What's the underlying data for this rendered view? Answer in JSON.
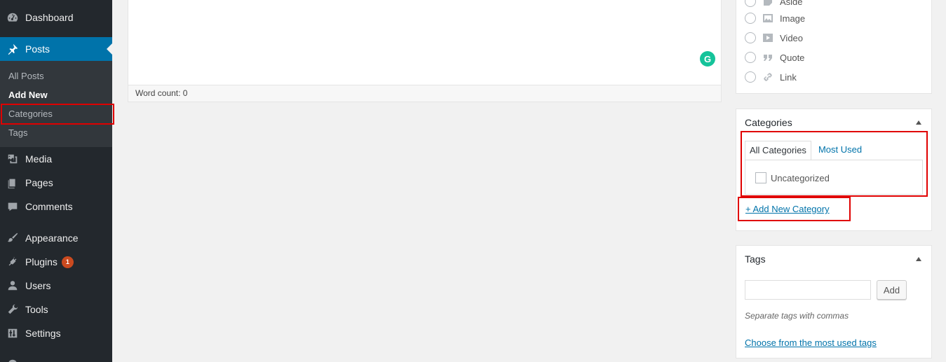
{
  "sidebar": {
    "dashboard": "Dashboard",
    "posts": "Posts",
    "posts_sub": [
      "All Posts",
      "Add New",
      "Categories",
      "Tags"
    ],
    "media": "Media",
    "pages": "Pages",
    "comments": "Comments",
    "appearance": "Appearance",
    "plugins": "Plugins",
    "plugins_badge": "1",
    "users": "Users",
    "tools": "Tools",
    "settings": "Settings"
  },
  "editor": {
    "word_count": "Word count: 0",
    "grammarly_letter": "G"
  },
  "format": {
    "options": [
      "Aside",
      "Image",
      "Video",
      "Quote",
      "Link"
    ]
  },
  "categories": {
    "title": "Categories",
    "tab_all": "All Categories",
    "tab_most_used": "Most Used",
    "items": [
      "Uncategorized"
    ],
    "add_new": "+ Add New Category"
  },
  "tags": {
    "title": "Tags",
    "add_button": "Add",
    "hint": "Separate tags with commas",
    "choose_link": "Choose from the most used tags"
  },
  "colors": {
    "sidebar_bg": "#23282d",
    "active_bg": "#0073aa",
    "link": "#0073aa",
    "highlight": "#e00000"
  }
}
